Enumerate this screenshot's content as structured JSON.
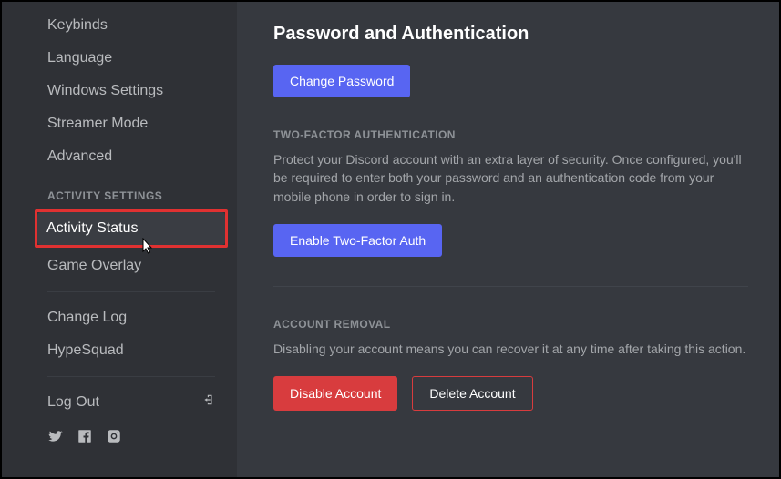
{
  "sidebar": {
    "items_top": [
      {
        "label": "Keybinds"
      },
      {
        "label": "Language"
      },
      {
        "label": "Windows Settings"
      },
      {
        "label": "Streamer Mode"
      },
      {
        "label": "Advanced"
      }
    ],
    "activity_header": "ACTIVITY SETTINGS",
    "items_activity": [
      {
        "label": "Activity Status"
      },
      {
        "label": "Game Overlay"
      }
    ],
    "items_misc": [
      {
        "label": "Change Log"
      },
      {
        "label": "HypeSquad"
      }
    ],
    "logout_label": "Log Out"
  },
  "main": {
    "title": "Password and Authentication",
    "change_password_label": "Change Password",
    "two_factor_header": "TWO-FACTOR AUTHENTICATION",
    "two_factor_text": "Protect your Discord account with an extra layer of security. Once configured, you'll be required to enter both your password and an authentication code from your mobile phone in order to sign in.",
    "enable_two_factor_label": "Enable Two-Factor Auth",
    "account_removal_header": "ACCOUNT REMOVAL",
    "account_removal_text": "Disabling your account means you can recover it at any time after taking this action.",
    "disable_account_label": "Disable Account",
    "delete_account_label": "Delete Account"
  }
}
